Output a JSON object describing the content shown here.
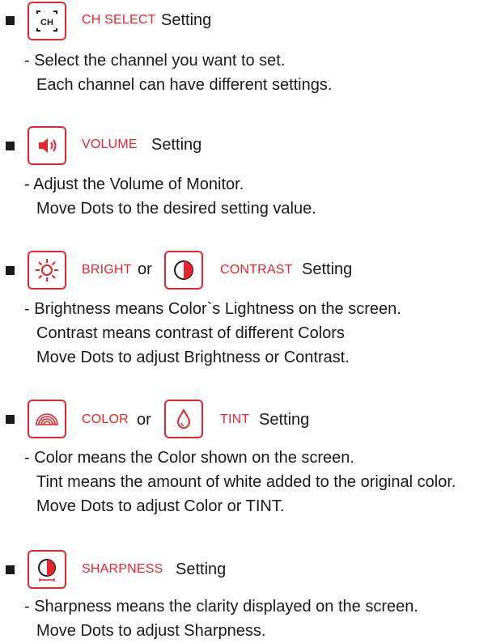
{
  "colors": {
    "accent": "#e8242e",
    "text": "#1a1a1a"
  },
  "sections": [
    {
      "icons": [
        "ch-icon"
      ],
      "ch_icon_text": "CH",
      "labels": [
        "CH SELECT"
      ],
      "setting_word": "Setting",
      "lines": [
        "- Select the channel you want to set.",
        "Each channel can have different settings."
      ]
    },
    {
      "icons": [
        "volume-icon"
      ],
      "labels": [
        "VOLUME"
      ],
      "setting_word": "Setting",
      "lines": [
        "- Adjust the Volume of Monitor.",
        "Move Dots to the desired setting value."
      ]
    },
    {
      "icons": [
        "brightness-icon",
        "contrast-icon"
      ],
      "labels": [
        "BRIGHT",
        "CONTRAST"
      ],
      "or_word": "or",
      "setting_word": "Setting",
      "lines": [
        "- Brightness means Color`s Lightness on the screen.",
        "Contrast means contrast of different Colors",
        "Move Dots to adjust Brightness or Contrast."
      ]
    },
    {
      "icons": [
        "color-rainbow-icon",
        "tint-drop-icon"
      ],
      "labels": [
        "COLOR",
        "TINT"
      ],
      "or_word": "or",
      "setting_word": "Setting",
      "lines": [
        "- Color means the Color shown on the screen.",
        "Tint means the amount of white added to the original color.",
        "Move Dots to adjust Color or TINT."
      ]
    },
    {
      "icons": [
        "sharpness-icon"
      ],
      "labels": [
        "SHARPNESS"
      ],
      "setting_word": "Setting",
      "lines": [
        "- Sharpness means the clarity displayed on the screen.",
        "Move Dots to adjust Sharpness."
      ]
    }
  ]
}
